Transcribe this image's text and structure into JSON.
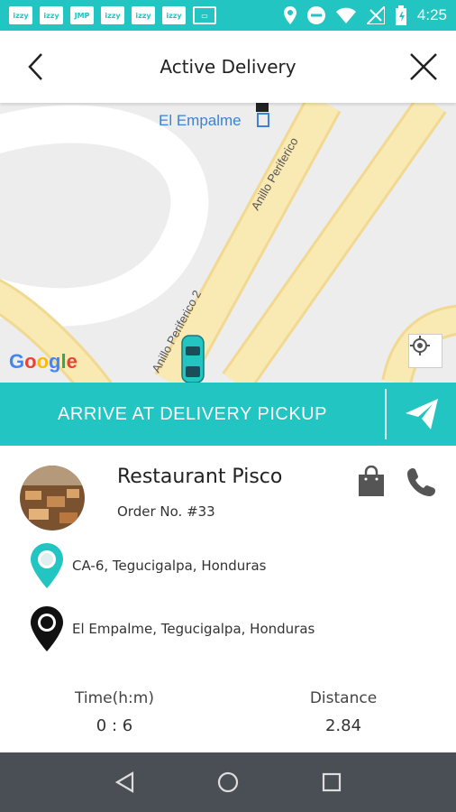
{
  "status_bar": {
    "time": "4:25",
    "notifications": [
      "izzy",
      "izzy",
      "JMP",
      "izzy",
      "izzy",
      "izzy"
    ],
    "icons": [
      "location-icon",
      "do-not-disturb-icon",
      "wifi-icon",
      "no-signal-icon",
      "battery-icon"
    ]
  },
  "header": {
    "title": "Active Delivery"
  },
  "map": {
    "place_label": "El Empalme",
    "road_1": "Anillo Periferico",
    "road_2": "Anillo Periferico 2",
    "provider_logo": "Google"
  },
  "actions": {
    "arrive_label": "ARRIVE AT DELIVERY PICKUP"
  },
  "order": {
    "restaurant_name": "Restaurant Pisco",
    "order_number": "Order No. #33",
    "pickup_address": "CA-6, Tegucigalpa, Honduras",
    "dropoff_address": "El Empalme, Tegucigalpa, Honduras"
  },
  "stats": {
    "time_label": "Time(h:m)",
    "time_value": "0 : 6",
    "distance_label": "Distance",
    "distance_value": "2.84"
  },
  "colors": {
    "accent": "#22C5C2",
    "road": "#F7E3A0",
    "navbar": "#4A4F55"
  }
}
